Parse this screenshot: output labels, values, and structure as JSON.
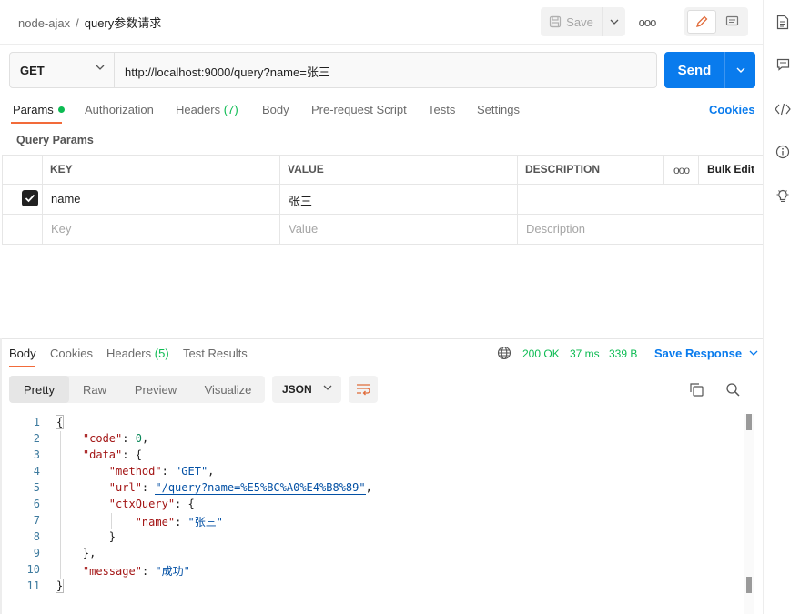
{
  "breadcrumb": {
    "collection": "node-ajax",
    "separator": "/",
    "request": "query参数请求"
  },
  "toolbar": {
    "save_label": "Save",
    "more_label": "ooo"
  },
  "request": {
    "method": "GET",
    "url": "http://localhost:9000/query?name=张三",
    "send_label": "Send"
  },
  "request_tabs": {
    "params": "Params",
    "authorization": "Authorization",
    "headers": "Headers",
    "headers_count": "(7)",
    "body": "Body",
    "pre_request": "Pre-request Script",
    "tests": "Tests",
    "settings": "Settings",
    "cookies": "Cookies"
  },
  "query_params": {
    "title": "Query Params",
    "columns": {
      "key": "KEY",
      "value": "VALUE",
      "description": "DESCRIPTION",
      "more": "ooo",
      "bulk_edit": "Bulk Edit"
    },
    "rows": [
      {
        "checked": true,
        "key": "name",
        "value": "张三",
        "description": ""
      }
    ],
    "placeholders": {
      "key": "Key",
      "value": "Value",
      "description": "Description"
    }
  },
  "response_tabs": {
    "body": "Body",
    "cookies": "Cookies",
    "headers": "Headers",
    "headers_count": "(5)",
    "test_results": "Test Results"
  },
  "response_status": {
    "status": "200 OK",
    "time": "37 ms",
    "size": "339 B",
    "save_response": "Save Response"
  },
  "view_modes": {
    "pretty": "Pretty",
    "raw": "Raw",
    "preview": "Preview",
    "visualize": "Visualize",
    "format": "JSON"
  },
  "code": {
    "line_numbers": [
      "1",
      "2",
      "3",
      "4",
      "5",
      "6",
      "7",
      "8",
      "9",
      "10",
      "11"
    ],
    "open_brace": "{",
    "close_brace": "}",
    "code_key": "\"code\"",
    "code_val": "0",
    "data_key": "\"data\"",
    "method_key": "\"method\"",
    "method_val": "\"GET\"",
    "url_key": "\"url\"",
    "url_val": "\"/query?name=%E5%BC%A0%E4%B8%89\"",
    "ctx_key": "\"ctxQuery\"",
    "name_key": "\"name\"",
    "name_val": "\"张三\"",
    "message_key": "\"message\"",
    "message_val": "\"成功\"",
    "colon": ": ",
    "comma": ","
  },
  "colors": {
    "accent": "#097bed",
    "tab_underline": "#f26b3a",
    "success": "#0cbb52"
  },
  "icons": [
    "save-icon",
    "chevron-down-icon",
    "more-icon",
    "edit-icon",
    "comment-icon",
    "documentation-icon",
    "comments-icon",
    "code-icon",
    "info-icon",
    "lightbulb-icon",
    "checkbox-icon",
    "globe-icon",
    "wrap-lines-icon",
    "copy-icon",
    "search-icon"
  ]
}
